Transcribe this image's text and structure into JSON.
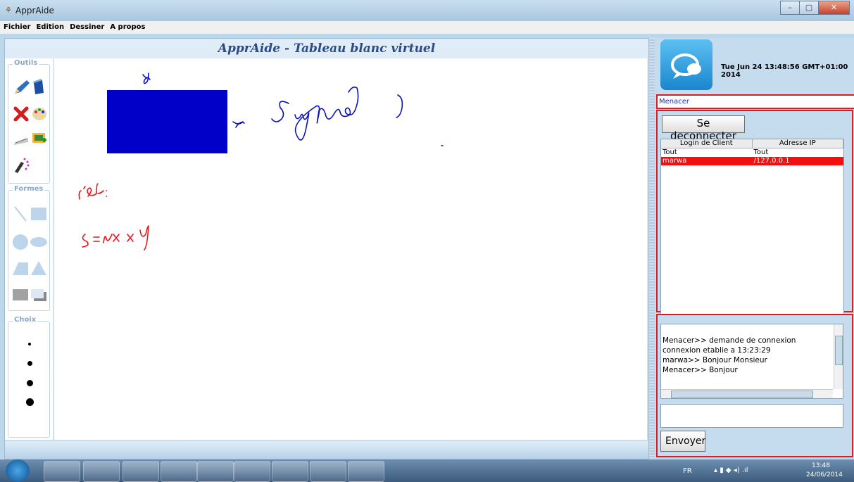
{
  "window": {
    "title": "ApprAide",
    "min_label": "–",
    "max_label": "▢",
    "close_label": "✕"
  },
  "menu": [
    {
      "label": "Fichier"
    },
    {
      "label": "Edition"
    },
    {
      "label": "Dessiner"
    },
    {
      "label": "A propos"
    }
  ],
  "board": {
    "title": "ApprAide - Tableau blanc virtuel"
  },
  "toolbar": {
    "outils_label": "Outils",
    "formes_label": "Formes",
    "choix_label": "Choix"
  },
  "drawing": {
    "rect_color": "#0000c8",
    "label_y": "y",
    "label_x": "x",
    "question": "Surface?",
    "answer_label": "c'est :",
    "formula": "S = x × y",
    "ink_blue": "#0c12b8",
    "ink_red": "#e8141a"
  },
  "right": {
    "datetime": "Tue Jun 24 13:48:56 GMT+01:00 2014",
    "user": "Menacer",
    "disconnect_label": "Se deconnecter",
    "send_label": "Envoyer",
    "message_input": ""
  },
  "clients": {
    "headers": [
      "Login de Client",
      "Adresse IP"
    ],
    "rows": [
      [
        "Tout",
        "Tout"
      ],
      [
        "marwa",
        "/127.0.0.1"
      ]
    ]
  },
  "chat": [
    "Menacer>> demande de connexion",
    "connexion etablie a 13:23:29",
    "marwa>> Bonjour Monsieur",
    "Menacer>> Bonjour"
  ],
  "taskbar": {
    "language": "FR",
    "time": "13:48",
    "date": "24/06/2014"
  }
}
